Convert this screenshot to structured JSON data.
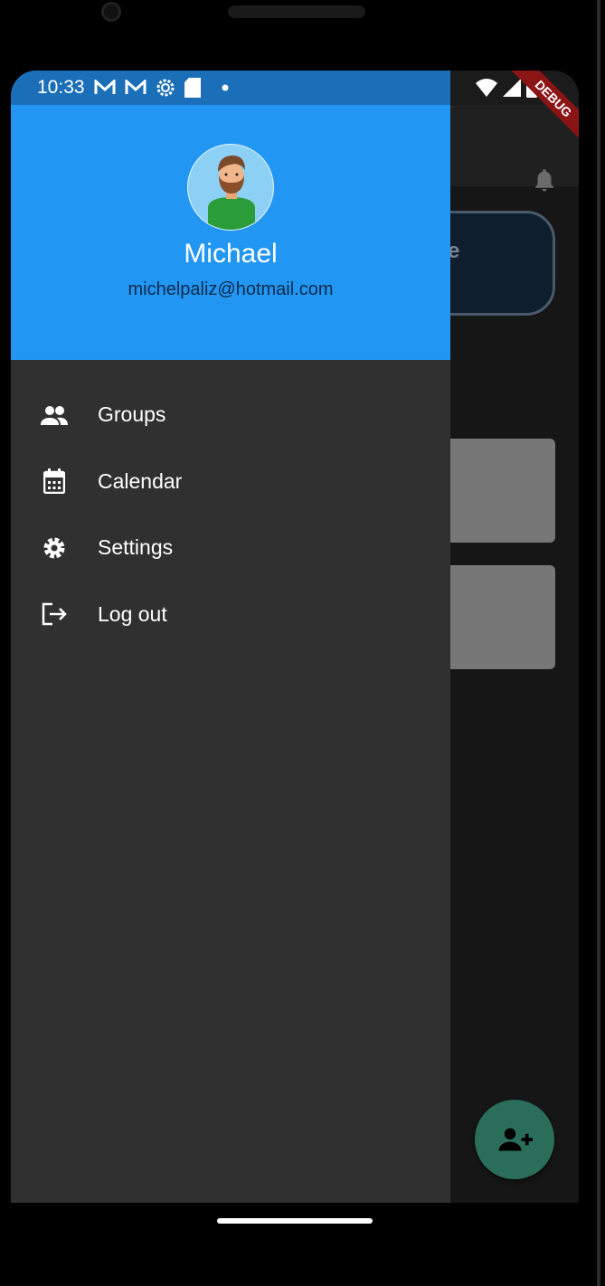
{
  "status_bar": {
    "time": "10:33",
    "icons": [
      "gmail-icon",
      "gmail-icon",
      "settings-icon",
      "sd-card-icon",
      "dot-icon"
    ],
    "right_icons": [
      "wifi-icon",
      "signal-icon",
      "battery-icon"
    ]
  },
  "debug_banner": "DEBUG",
  "drawer": {
    "user": {
      "name": "Michael",
      "email": "michelpaliz@hotmail.com"
    },
    "items": [
      {
        "label": "Groups",
        "icon": "groups-icon"
      },
      {
        "label": "Calendar",
        "icon": "calendar-icon"
      },
      {
        "label": "Settings",
        "icon": "settings-icon"
      },
      {
        "label": "Log out",
        "icon": "logout-icon"
      }
    ]
  },
  "background": {
    "partial_text": "e",
    "fab_icon": "add-person-icon"
  },
  "colors": {
    "header": "#2196f3",
    "drawer": "#303030",
    "status": "#1a6fb8",
    "fab": "#2a6e5a"
  }
}
